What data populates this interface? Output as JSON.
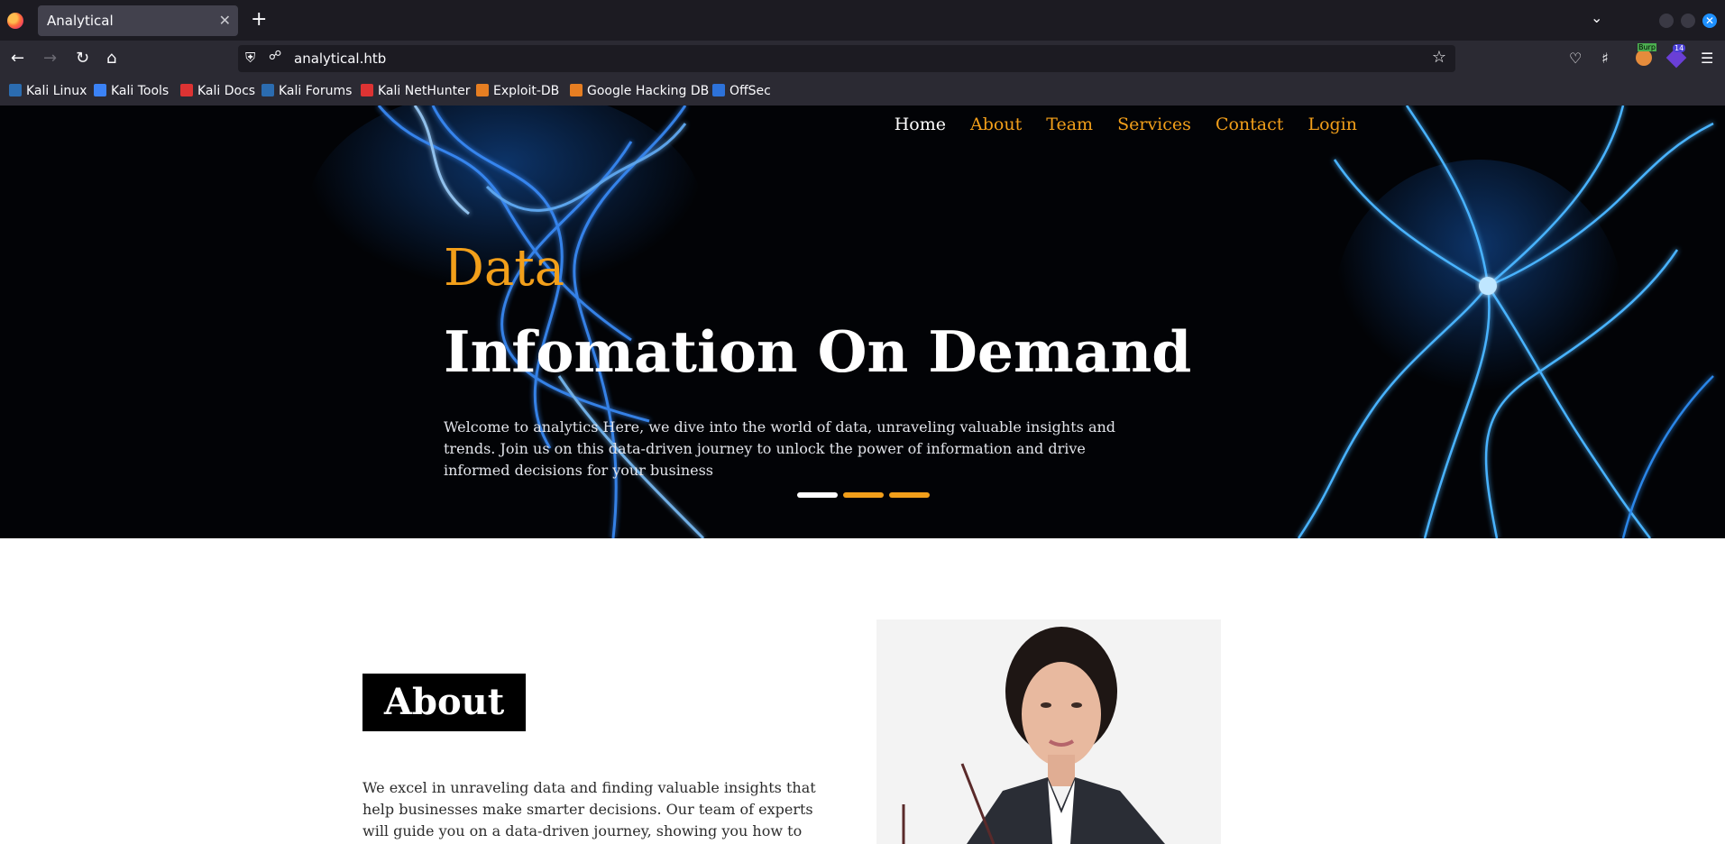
{
  "browser": {
    "tab_title": "Analytical",
    "tab_close_glyph": "✕",
    "new_tab_glyph": "+",
    "url": "analytical.htb",
    "ext_burp_badge": "Burp",
    "ext_badge_count": "14",
    "bookmarks": [
      {
        "label": "Kali Linux",
        "icon_color": "#2b6cb0"
      },
      {
        "label": "Kali Tools",
        "icon_color": "#3b82f6"
      },
      {
        "label": "Kali Docs",
        "icon_color": "#d33"
      },
      {
        "label": "Kali Forums",
        "icon_color": "#2b6cb0"
      },
      {
        "label": "Kali NetHunter",
        "icon_color": "#d33"
      },
      {
        "label": "Exploit-DB",
        "icon_color": "#e67e22"
      },
      {
        "label": "Google Hacking DB",
        "icon_color": "#e67e22"
      },
      {
        "label": "OffSec",
        "icon_color": "#2d72d9"
      }
    ]
  },
  "site": {
    "nav": [
      "Home",
      "About",
      "Team",
      "Services",
      "Contact",
      "Login"
    ],
    "hero": {
      "kicker": "Data",
      "title": "Infomation On Demand",
      "text": "Welcome to analytics Here, we dive into the world of data, unraveling valuable insights and trends. Join us on this data-driven journey to unlock the power of information and drive informed decisions for your business"
    },
    "about": {
      "heading": "About",
      "text": "We excel in unraveling data and finding valuable insights that help businesses make smarter decisions. Our team of experts will guide you on a data-driven journey, showing you how to harness the power of"
    }
  },
  "colors": {
    "accent": "#f29f1a",
    "hero_bg": "#020306",
    "smoke": "#2f8fff"
  }
}
